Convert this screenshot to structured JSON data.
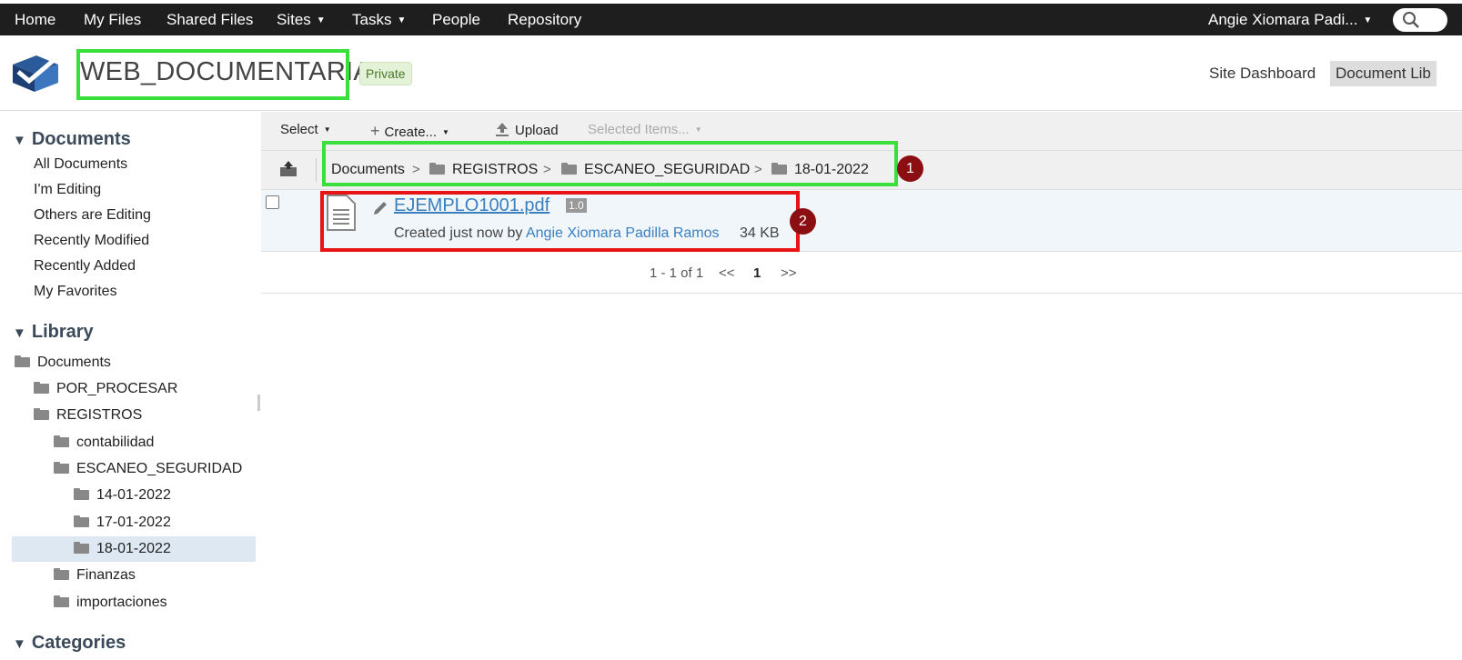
{
  "topnav": {
    "items": [
      "Home",
      "My Files",
      "Shared Files",
      "Sites",
      "Tasks",
      "People",
      "Repository"
    ],
    "user": "Angie Xiomara Padi..."
  },
  "site": {
    "title": "WEB_DOCUMENTARIA",
    "badge": "Private",
    "links": [
      "Site Dashboard",
      "Document Lib"
    ]
  },
  "sidebar": {
    "documents_heading": "Documents",
    "document_filters": [
      "All Documents",
      "I'm Editing",
      "Others are Editing",
      "Recently Modified",
      "Recently Added",
      "My Favorites"
    ],
    "library_heading": "Library",
    "tree": [
      "Documents",
      "POR_PROCESAR",
      "REGISTROS",
      "contabilidad",
      "ESCANEO_SEGURIDAD",
      "14-01-2022",
      "17-01-2022",
      "18-01-2022",
      "Finanzas",
      "importaciones"
    ],
    "categories_heading": "Categories"
  },
  "toolbar": {
    "select": "Select",
    "create": "Create...",
    "upload": "Upload",
    "selected_items": "Selected Items..."
  },
  "breadcrumb": {
    "items": [
      "Documents",
      "REGISTROS",
      "ESCANEO_SEGURIDAD",
      "18-01-2022"
    ],
    "separator": ">"
  },
  "annotations": {
    "badge1": "1",
    "badge2": "2"
  },
  "file": {
    "name": "EJEMPLO1001.pdf",
    "version": "1.0",
    "created_prefix": "Created just now by",
    "author": "Angie Xiomara Padilla Ramos",
    "size": "34 KB"
  },
  "pager": {
    "range": "1 - 1 of 1",
    "prev": "<<",
    "current": "1",
    "next": ">>"
  },
  "colors": {
    "topbar": "#1e1e1e",
    "highlight_green": "#39e039",
    "highlight_red": "#e81414",
    "badge": "#8b0f12",
    "link": "#3a7fc0"
  }
}
